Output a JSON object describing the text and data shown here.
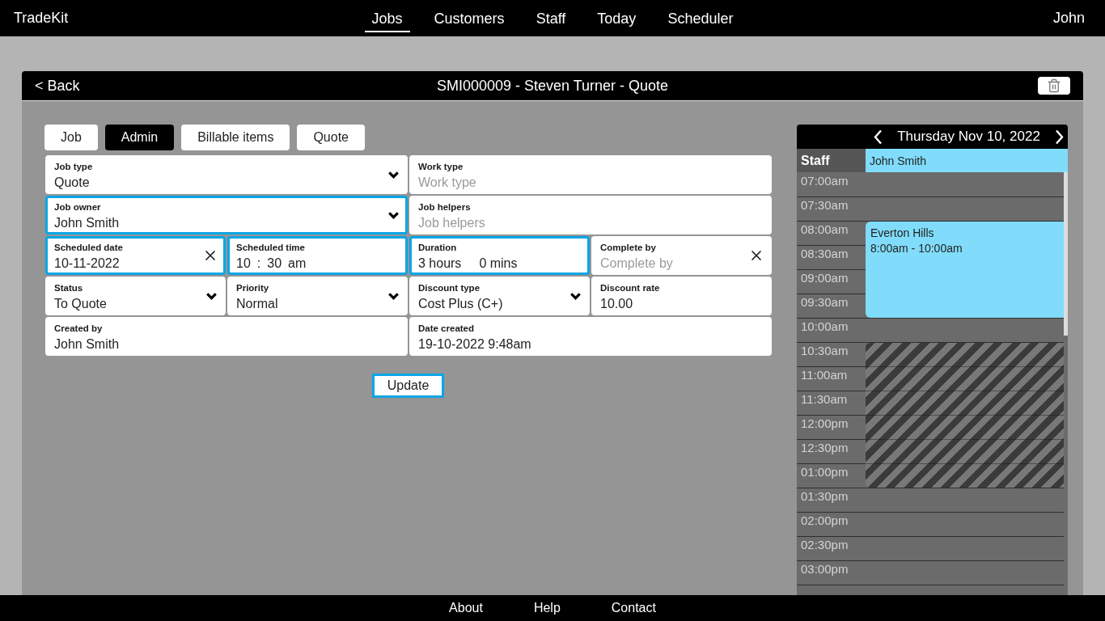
{
  "app": {
    "brand": "TradeKit",
    "user": "John"
  },
  "nav": [
    {
      "label": "Jobs",
      "selected": true
    },
    {
      "label": "Customers",
      "selected": false
    },
    {
      "label": "Staff",
      "selected": false
    },
    {
      "label": "Today",
      "selected": false
    },
    {
      "label": "Scheduler",
      "selected": false
    }
  ],
  "page_header": {
    "back": "< Back",
    "title": "SMI000009 - Steven Turner - Quote"
  },
  "tabs": [
    {
      "label": "Job",
      "selected": false
    },
    {
      "label": "Admin",
      "selected": true
    },
    {
      "label": "Billable items",
      "selected": false
    },
    {
      "label": "Quote",
      "selected": false
    }
  ],
  "form_rows": [
    [
      {
        "kind": "select",
        "label": "Job type",
        "value": "Quote",
        "highlighted": false
      },
      {
        "kind": "text",
        "label": "Work type",
        "placeholder": "Work type",
        "highlighted": false
      }
    ],
    [
      {
        "kind": "select",
        "label": "Job owner",
        "value": "John Smith",
        "highlighted": true
      },
      {
        "kind": "text",
        "label": "Job helpers",
        "placeholder": "Job helpers",
        "highlighted": false
      }
    ],
    [
      {
        "kind": "date",
        "label": "Scheduled date",
        "value": "10-11-2022",
        "highlighted": true
      },
      {
        "kind": "time",
        "label": "Scheduled time",
        "parts": [
          "10",
          ":",
          "30",
          "am"
        ],
        "highlighted": true
      },
      {
        "kind": "duration",
        "label": "Duration",
        "parts": [
          "3 hours",
          "0 mins"
        ],
        "highlighted": true
      },
      {
        "kind": "date",
        "label": "Complete by",
        "placeholder": "Complete by",
        "highlighted": false
      }
    ],
    [
      {
        "kind": "select",
        "label": "Status",
        "value": "To Quote",
        "highlighted": false
      },
      {
        "kind": "select",
        "label": "Priority",
        "value": "Normal",
        "highlighted": false
      },
      {
        "kind": "select",
        "label": "Discount type",
        "value": "Cost Plus (C+)",
        "highlighted": false
      },
      {
        "kind": "text",
        "label": "Discount rate",
        "value": "10.00",
        "highlighted": false
      }
    ],
    [
      {
        "kind": "text",
        "label": "Created by",
        "value": "John Smith",
        "highlighted": false
      },
      {
        "kind": "text",
        "label": "Date created",
        "value": "19-10-2022 9:48am",
        "highlighted": false
      }
    ]
  ],
  "update_button": "Update",
  "calendar": {
    "date": "Thursday Nov 10, 2022",
    "staff_heading": "Staff",
    "staff": [
      {
        "name": "John Smith"
      }
    ],
    "slots": [
      {
        "time": "07:00am",
        "kind": "free"
      },
      {
        "time": "07:30am",
        "kind": "free"
      },
      {
        "time": "08:00am",
        "kind": "booked",
        "event": {
          "title": "Everton Hills",
          "time": "8:00am - 10:00am"
        }
      },
      {
        "time": "08:30am",
        "kind": "booked"
      },
      {
        "time": "09:00am",
        "kind": "booked"
      },
      {
        "time": "09:30am",
        "kind": "booked"
      },
      {
        "time": "10:00am",
        "kind": "free"
      },
      {
        "time": "10:30am",
        "kind": "blocked"
      },
      {
        "time": "11:00am",
        "kind": "blocked"
      },
      {
        "time": "11:30am",
        "kind": "blocked"
      },
      {
        "time": "12:00pm",
        "kind": "blocked"
      },
      {
        "time": "12:30pm",
        "kind": "blocked"
      },
      {
        "time": "01:00pm",
        "kind": "blocked"
      },
      {
        "time": "01:30pm",
        "kind": "free"
      },
      {
        "time": "02:00pm",
        "kind": "free"
      },
      {
        "time": "02:30pm",
        "kind": "free"
      },
      {
        "time": "03:00pm",
        "kind": "free"
      },
      {
        "kind": "free"
      }
    ]
  },
  "footer": [
    "About",
    "Help",
    "Contact"
  ]
}
